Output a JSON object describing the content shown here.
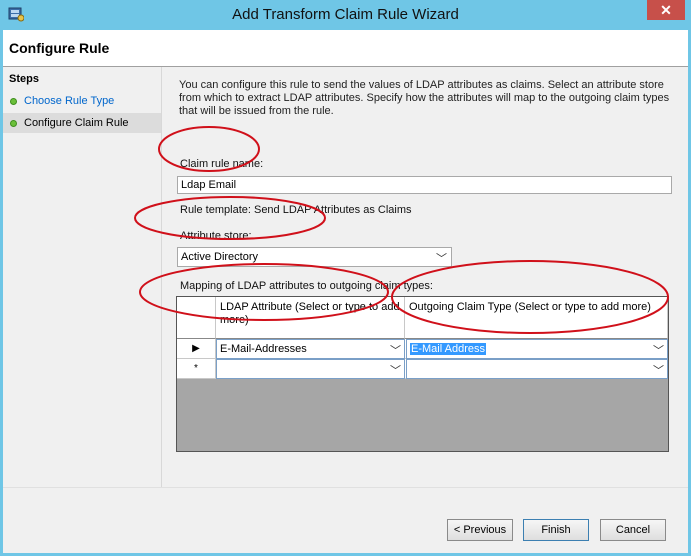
{
  "window": {
    "title": "Add Transform Claim Rule Wizard",
    "close_glyph": "✕"
  },
  "header": {
    "title": "Configure Rule"
  },
  "steps": {
    "title": "Steps",
    "items": [
      {
        "label": "Choose Rule Type"
      },
      {
        "label": "Configure Claim Rule"
      }
    ]
  },
  "intro": "You can configure this rule to send the values of LDAP attributes as claims. Select an attribute store from which to extract LDAP attributes. Specify how the attributes will map to the outgoing claim types that will be issued from the rule.",
  "rule_name": {
    "label": "Claim rule name:",
    "value": "Ldap Email"
  },
  "rule_template": "Rule template: Send LDAP Attributes as Claims",
  "attribute_store": {
    "label": "Attribute store:",
    "value": "Active Directory"
  },
  "mapping": {
    "label": "Mapping of LDAP attributes to outgoing claim types:",
    "columns": [
      "LDAP Attribute (Select or type to add more)",
      "Outgoing Claim Type (Select or type to add more)"
    ],
    "rows": [
      {
        "marker": "▶",
        "ldap": "E-Mail-Addresses",
        "claim": "E-Mail Address"
      },
      {
        "marker": "*",
        "ldap": "",
        "claim": ""
      }
    ]
  },
  "buttons": {
    "previous": "< Previous",
    "finish": "Finish",
    "cancel": "Cancel"
  },
  "colors": {
    "titlebar": "#6fc6e6",
    "annotation": "#d0101a",
    "selection": "#3399ff"
  },
  "icons": {
    "app": "wizard-app-icon",
    "dropdown": "chevron-down-icon"
  }
}
